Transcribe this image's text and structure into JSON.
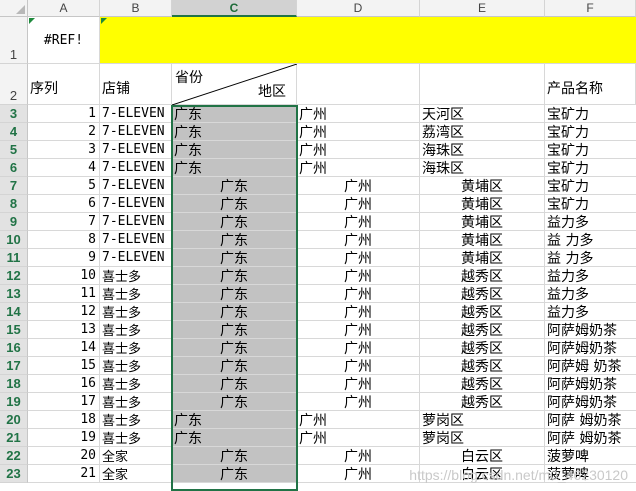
{
  "columns": [
    "A",
    "B",
    "C",
    "D",
    "E",
    "F"
  ],
  "selected_column": "C",
  "row1": {
    "row": "1",
    "a1": "#REF!"
  },
  "row2": {
    "row": "2",
    "seq": "序列",
    "store": "店铺",
    "province": "省份",
    "district": "地区",
    "product": "产品名称"
  },
  "rows": [
    {
      "row": "3",
      "n": "1",
      "store": "7-ELEVEN",
      "prov": "广东",
      "city": "广州",
      "dist": "天河区",
      "prod": "宝矿力",
      "align": "left"
    },
    {
      "row": "4",
      "n": "2",
      "store": "7-ELEVEN",
      "prov": "广东",
      "city": "广州",
      "dist": "荔湾区",
      "prod": "宝矿力",
      "align": "left"
    },
    {
      "row": "5",
      "n": "3",
      "store": "7-ELEVEN",
      "prov": "广东",
      "city": "广州",
      "dist": "海珠区",
      "prod": "宝矿力",
      "align": "left"
    },
    {
      "row": "6",
      "n": "4",
      "store": "7-ELEVEN",
      "prov": "广东",
      "city": "广州",
      "dist": "海珠区",
      "prod": "宝矿力",
      "align": "left"
    },
    {
      "row": "7",
      "n": "5",
      "store": "7-ELEVEN",
      "prov": "广东",
      "city": "广州",
      "dist": "黄埔区",
      "prod": "宝矿力",
      "align": "center"
    },
    {
      "row": "8",
      "n": "6",
      "store": "7-ELEVEN",
      "prov": "广东",
      "city": "广州",
      "dist": "黄埔区",
      "prod": "宝矿力",
      "align": "center"
    },
    {
      "row": "9",
      "n": "7",
      "store": "7-ELEVEN",
      "prov": "广东",
      "city": "广州",
      "dist": "黄埔区",
      "prod": "益力多",
      "align": "center"
    },
    {
      "row": "10",
      "n": "8",
      "store": "7-ELEVEN",
      "prov": "广东",
      "city": "广州",
      "dist": "黄埔区",
      "prod": "益 力多",
      "align": "center"
    },
    {
      "row": "11",
      "n": "9",
      "store": "7-ELEVEN",
      "prov": "广东",
      "city": "广州",
      "dist": "黄埔区",
      "prod": "益 力多",
      "align": "center"
    },
    {
      "row": "12",
      "n": "10",
      "store": "喜士多",
      "prov": "广东",
      "city": "广州",
      "dist": "越秀区",
      "prod": "益力多",
      "align": "center"
    },
    {
      "row": "13",
      "n": "11",
      "store": "喜士多",
      "prov": "广东",
      "city": "广州",
      "dist": "越秀区",
      "prod": "益力多",
      "align": "center"
    },
    {
      "row": "14",
      "n": "12",
      "store": "喜士多",
      "prov": "广东",
      "city": "广州",
      "dist": "越秀区",
      "prod": "益力多",
      "align": "center"
    },
    {
      "row": "15",
      "n": "13",
      "store": "喜士多",
      "prov": "广东",
      "city": "广州",
      "dist": "越秀区",
      "prod": "阿萨姆奶茶",
      "align": "center"
    },
    {
      "row": "16",
      "n": "14",
      "store": "喜士多",
      "prov": "广东",
      "city": "广州",
      "dist": "越秀区",
      "prod": "阿萨姆奶茶",
      "align": "center"
    },
    {
      "row": "17",
      "n": "15",
      "store": "喜士多",
      "prov": "广东",
      "city": "广州",
      "dist": "越秀区",
      "prod": "阿萨姆 奶茶",
      "align": "center"
    },
    {
      "row": "18",
      "n": "16",
      "store": "喜士多",
      "prov": "广东",
      "city": "广州",
      "dist": "越秀区",
      "prod": "阿萨姆奶茶",
      "align": "center"
    },
    {
      "row": "19",
      "n": "17",
      "store": "喜士多",
      "prov": "广东",
      "city": "广州",
      "dist": "越秀区",
      "prod": "阿萨姆奶茶",
      "align": "center"
    },
    {
      "row": "20",
      "n": "18",
      "store": "喜士多",
      "prov": "广东",
      "city": "广州",
      "dist": "萝岗区",
      "prod": "阿萨 姆奶茶",
      "align": "left"
    },
    {
      "row": "21",
      "n": "19",
      "store": "喜士多",
      "prov": "广东",
      "city": "广州",
      "dist": "萝岗区",
      "prod": "阿萨 姆奶茶",
      "align": "left"
    },
    {
      "row": "22",
      "n": "20",
      "store": "全家",
      "prov": "广东",
      "city": "广州",
      "dist": "白云区",
      "prod": "菠萝啤",
      "align": "center"
    },
    {
      "row": "23",
      "n": "21",
      "store": "全家",
      "prov": "广东",
      "city": "广州",
      "dist": "白云区",
      "prod": "菠萝啤",
      "align": "center"
    }
  ],
  "watermark": "https://blog.csdn.net/m0_46230120",
  "colors": {
    "header_bg": "#f3f3f3",
    "selected_col_bg": "#c2c2c2",
    "accent": "#217346",
    "highlight": "#ffff00"
  }
}
